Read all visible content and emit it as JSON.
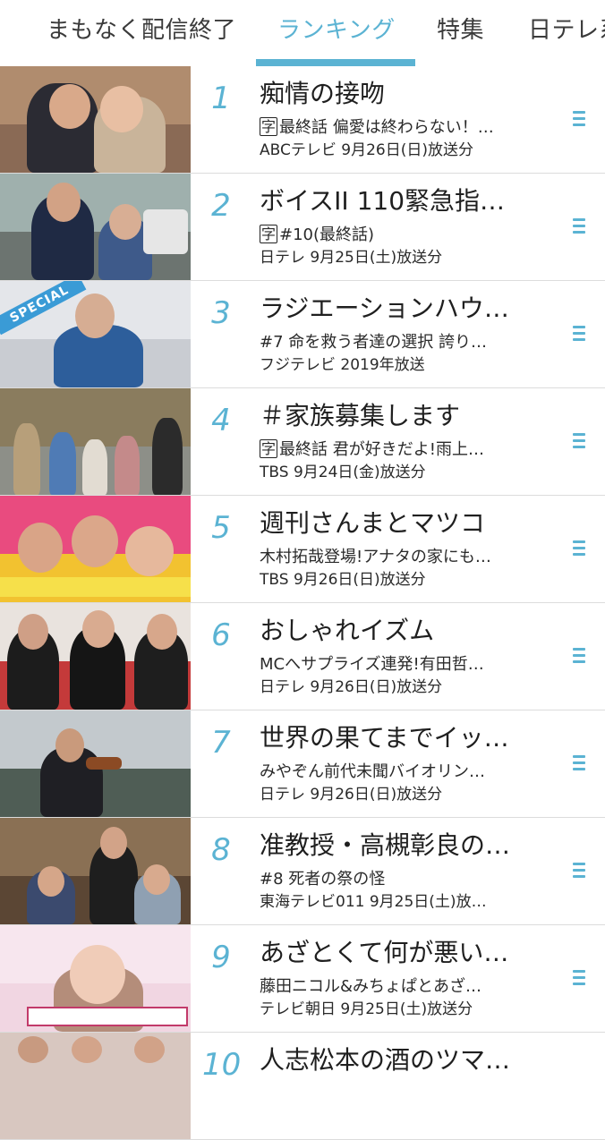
{
  "tabs": [
    {
      "label": "まもなく配信終了"
    },
    {
      "label": "ランキング"
    },
    {
      "label": "特集"
    },
    {
      "label": "日テレ系"
    }
  ],
  "accent_color": "#5bb3d3",
  "badge_label": "字",
  "special_label": "SPECIAL",
  "rows": [
    {
      "rank": "1",
      "title": "痴情の接吻",
      "badge": true,
      "subtitle": "最終話 偏愛は終わらない！…",
      "meta": "ABCテレビ  9月26日(日)放送分"
    },
    {
      "rank": "2",
      "title": "ボイスII 110緊急指…",
      "badge": true,
      "subtitle": "#10(最終話)",
      "meta": "日テレ  9月25日(土)放送分"
    },
    {
      "rank": "3",
      "title": "ラジエーションハウ…",
      "badge": false,
      "subtitle": "#7 命を救う者達の選択 誇り…",
      "meta": "フジテレビ  2019年放送"
    },
    {
      "rank": "4",
      "title": "＃家族募集します",
      "badge": true,
      "subtitle": "最終話 君が好きだよ!雨上…",
      "meta": "TBS  9月24日(金)放送分"
    },
    {
      "rank": "5",
      "title": "週刊さんまとマツコ",
      "badge": false,
      "subtitle": "木村拓哉登場!アナタの家にも…",
      "meta": "TBS  9月26日(日)放送分"
    },
    {
      "rank": "6",
      "title": "おしゃれイズム",
      "badge": false,
      "subtitle": "MCへサプライズ連発!有田哲…",
      "meta": "日テレ  9月26日(日)放送分"
    },
    {
      "rank": "7",
      "title": "世界の果てまでイッ…",
      "badge": false,
      "subtitle": "みやぞん前代未聞バイオリン…",
      "meta": "日テレ  9月26日(日)放送分"
    },
    {
      "rank": "8",
      "title": "准教授・高槻彰良の…",
      "badge": false,
      "subtitle": "#8 死者の祭の怪",
      "meta": "東海テレビ011  9月25日(土)放…"
    },
    {
      "rank": "9",
      "title": "あざとくて何が悪い…",
      "badge": false,
      "subtitle": "藤田ニコル&みちょぱとあざ…",
      "meta": "テレビ朝日  9月25日(土)放送分"
    },
    {
      "rank": "10",
      "title": "人志松本の酒のツマ…",
      "badge": false,
      "subtitle": "",
      "meta": ""
    }
  ]
}
